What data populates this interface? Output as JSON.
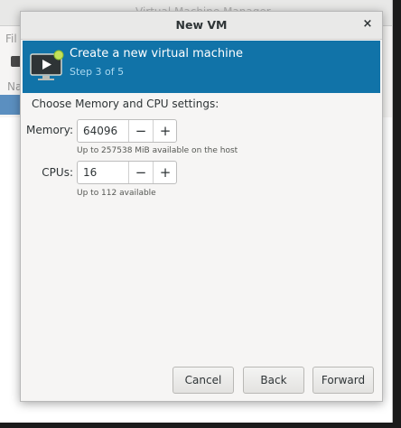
{
  "background_window": {
    "title": "Virtual Machine Manager",
    "menu_label": "Fil",
    "column_label": "Na"
  },
  "dialog": {
    "title": "New VM",
    "close_glyph": "×",
    "header": {
      "heading": "Create a new virtual machine",
      "step": "Step 3 of 5"
    },
    "section_label": "Choose Memory and CPU settings:",
    "memory": {
      "label": "Memory:",
      "value": "64096",
      "minus": "−",
      "plus": "+",
      "hint": "Up to 257538 MiB available on the host"
    },
    "cpus": {
      "label": "CPUs:",
      "value": "16",
      "minus": "−",
      "plus": "+",
      "hint": "Up to 112 available"
    },
    "buttons": {
      "cancel": "Cancel",
      "back": "Back",
      "forward": "Forward"
    }
  },
  "colors": {
    "header_bg": "#1173a8",
    "header_subtext": "#a9d8f0"
  },
  "icons": {
    "header_icon": "monitor-play-icon",
    "close_icon": "close-icon"
  }
}
